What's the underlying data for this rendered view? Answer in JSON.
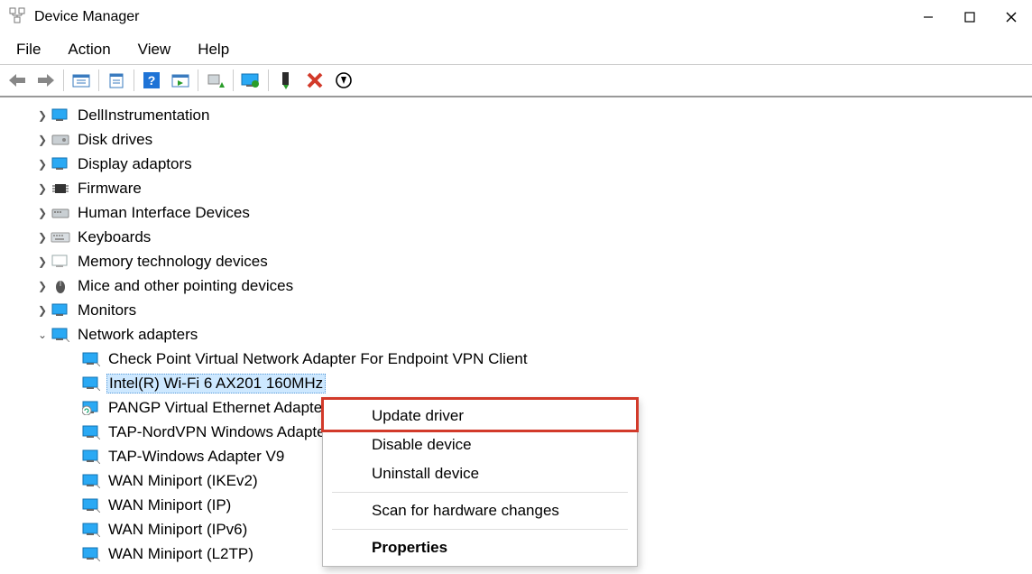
{
  "titlebar": {
    "title": "Device Manager"
  },
  "menubar": {
    "items": [
      "File",
      "Action",
      "View",
      "Help"
    ]
  },
  "toolbar": {
    "buttons": [
      "back-arrow",
      "forward-arrow",
      "sep",
      "list-btn",
      "sep",
      "props-btn",
      "sep",
      "help-btn",
      "playlist-btn",
      "sep",
      "addhw-btn",
      "sep",
      "monitor-color-btn",
      "sep",
      "plug-up-btn",
      "x-red-btn",
      "down-circle-btn"
    ]
  },
  "tree": {
    "categories": [
      {
        "label": "DellInstrumentation",
        "expanded": false,
        "icon": "device-generic"
      },
      {
        "label": "Disk drives",
        "expanded": false,
        "icon": "disk"
      },
      {
        "label": "Display adaptors",
        "expanded": false,
        "icon": "display"
      },
      {
        "label": "Firmware",
        "expanded": false,
        "icon": "chip"
      },
      {
        "label": "Human Interface Devices",
        "expanded": false,
        "icon": "hid"
      },
      {
        "label": "Keyboards",
        "expanded": false,
        "icon": "keyboard"
      },
      {
        "label": "Memory technology devices",
        "expanded": false,
        "icon": "memory"
      },
      {
        "label": "Mice and other pointing devices",
        "expanded": false,
        "icon": "mouse"
      },
      {
        "label": "Monitors",
        "expanded": false,
        "icon": "monitor"
      },
      {
        "label": "Network adapters",
        "expanded": true,
        "icon": "network",
        "children": [
          {
            "label": "Check Point Virtual Network Adapter For Endpoint VPN Client",
            "selected": false
          },
          {
            "label": "Intel(R) Wi-Fi 6 AX201 160MHz",
            "selected": true
          },
          {
            "label": "PANGP Virtual Ethernet Adapter",
            "selected": false,
            "icon_overlay": "refresh"
          },
          {
            "label": "TAP-NordVPN Windows Adapter",
            "selected": false
          },
          {
            "label": "TAP-Windows Adapter V9",
            "selected": false
          },
          {
            "label": "WAN Miniport (IKEv2)",
            "selected": false
          },
          {
            "label": "WAN Miniport (IP)",
            "selected": false
          },
          {
            "label": "WAN Miniport (IPv6)",
            "selected": false
          },
          {
            "label": "WAN Miniport (L2TP)",
            "selected": false
          }
        ]
      }
    ]
  },
  "context_menu": {
    "items": [
      {
        "label": "Update driver",
        "highlighted": true
      },
      {
        "label": "Disable device",
        "highlighted": false
      },
      {
        "label": "Uninstall device",
        "highlighted": false
      },
      {
        "sep": true
      },
      {
        "label": "Scan for hardware changes",
        "highlighted": false
      },
      {
        "sep": true
      },
      {
        "label": "Properties",
        "highlighted": false,
        "bold": true
      }
    ]
  }
}
